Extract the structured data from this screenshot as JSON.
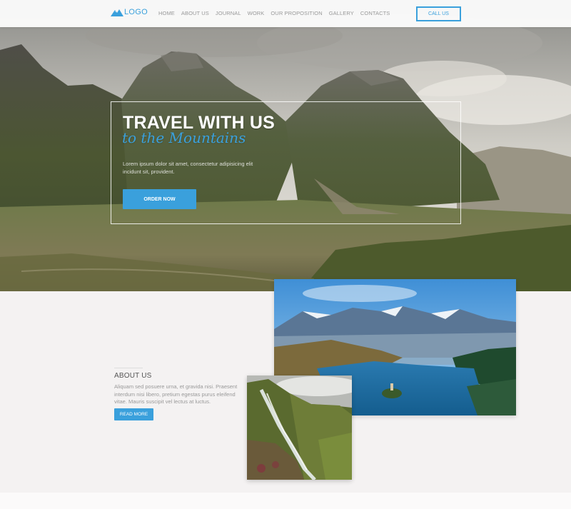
{
  "header": {
    "logo_text": "LOGO",
    "nav": [
      "HOME",
      "ABOUT US",
      "JOURNAL",
      "WORK",
      "OUR PROPOSITION",
      "GALLERY",
      "CONTACTS"
    ],
    "call_label": "CALL US"
  },
  "hero": {
    "title": "TRAVEL WITH US",
    "script": "to the Mountains",
    "text": "Lorem ipsum dolor sit amet, consectetur adipisicing elit incidunt sit, provident.",
    "order_label": "ORDER NOW"
  },
  "about": {
    "title": "ABOUT US",
    "text": "Aliquam sed posuere urna, et gravida nisi. Praesent interdum nisi libero, pretium egestas purus eleifend vitae. Mauris suscipit vel lectus at luctus.",
    "read_label": "READ MORE"
  },
  "colors": {
    "accent": "#3aa0dc",
    "background": "#f4f2f2"
  },
  "icons": {
    "logo": "mountain-logo-icon"
  }
}
